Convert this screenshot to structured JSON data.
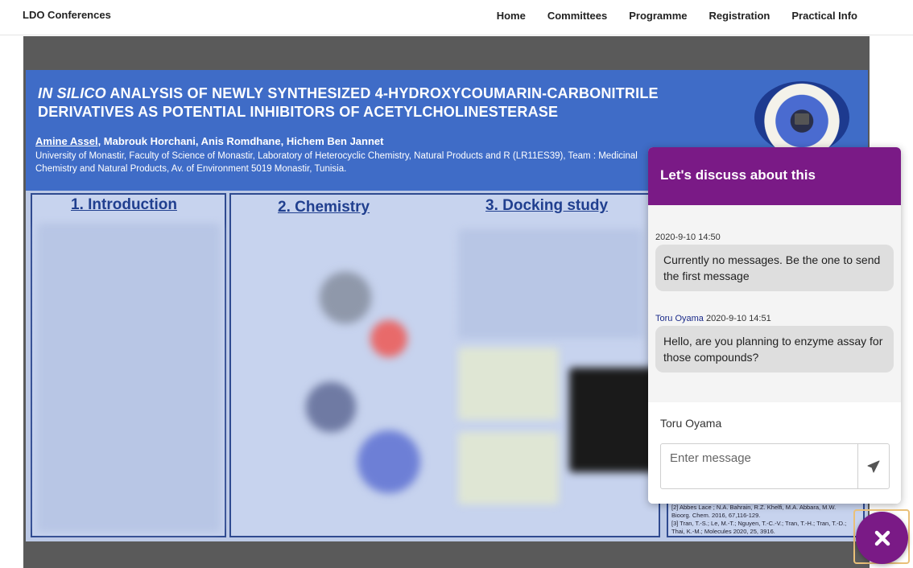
{
  "navbar": {
    "brand": "LDO Conferences",
    "links": [
      "Home",
      "Committees",
      "Programme",
      "Registration",
      "Practical Info"
    ]
  },
  "poster": {
    "title_italic": "IN SILICO",
    "title_rest": " ANALYSIS OF NEWLY SYNTHESIZED 4-HYDROXYCOUMARIN-CARBONITRILE DERIVATIVES AS POTENTIAL INHIBITORS OF ACETYLCHOLINESTERASE",
    "lead_author": "Amine Assel",
    "other_authors": ", Mabrouk Horchani, Anis Romdhane, Hichem Ben Jannet",
    "affiliation": "University of Monastir, Faculty of Science of Monastir, Laboratory of Heterocyclic Chemistry, Natural Products and R (LR11ES39), Team : Medicinal Chemistry and Natural Products, Av. of Environment 5019 Monastir, Tunisia.",
    "section_intro": "1. Introduction",
    "section_chemistry": "2. Chemistry",
    "section_docking": "3. Docking study",
    "refs_line1": "[2] Abbes Lace ; N.A. Bahrain, R.Z. Khelfi, M.A. Abbara, M.W.",
    "refs_line2": "Bioorg. Chem. 2016, 67,116-129.",
    "refs_line3": "[3] Tran, T.-S.; Le, M.-T.; Nguyen, T.-C.-V.; Tran, T.-H.; Tran, T.-D.;",
    "refs_line4": "Thai, K.-M.; Molecules 2020, 25, 3916."
  },
  "chat": {
    "header": "Let's discuss about this",
    "messages": [
      {
        "author": "",
        "timestamp": "2020-9-10 14:50",
        "text": "Currently no messages. Be the one to send the first message"
      },
      {
        "author": "Toru Oyama",
        "timestamp": "2020-9-10 14:51",
        "text": "Hello, are you planning to enzyme assay for those compounds?"
      }
    ],
    "user_name": "Toru Oyama",
    "input_placeholder": "Enter message",
    "send_icon": "paper-plane-icon"
  },
  "fab": {
    "icon": "close-icon"
  },
  "colors": {
    "accent": "#7a1a86",
    "poster_blue": "#3f6cc7"
  }
}
